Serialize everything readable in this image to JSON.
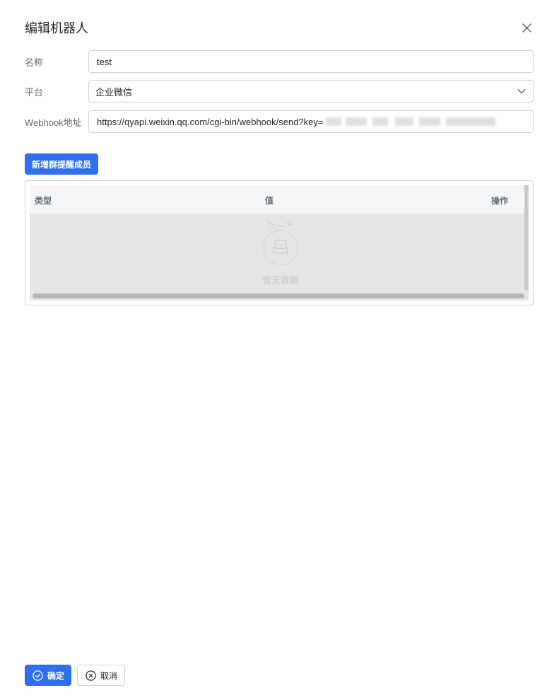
{
  "dialog": {
    "title": "编辑机器人"
  },
  "form": {
    "name_label": "名称",
    "name_value": "test",
    "platform_label": "平台",
    "platform_value": "企业微信",
    "webhook_label": "Webhook地址",
    "webhook_value": "https://qyapi.weixin.qq.com/cgi-bin/webhook/send?key="
  },
  "members": {
    "add_button_label": "新增群提醒成员",
    "columns": [
      "类型",
      "值",
      "操作"
    ],
    "rows": [],
    "empty_text": "暂无数据"
  },
  "footer": {
    "confirm_label": "确定",
    "cancel_label": "取消"
  },
  "colors": {
    "primary": "#2f6ff2",
    "border": "#d0d3d6",
    "label_text": "#646a73"
  },
  "icons": {
    "close": "close-icon",
    "select_arrow": "chevron-down-icon",
    "empty": "empty-box-icon",
    "confirm": "check-circle-icon",
    "cancel": "close-circle-icon"
  }
}
